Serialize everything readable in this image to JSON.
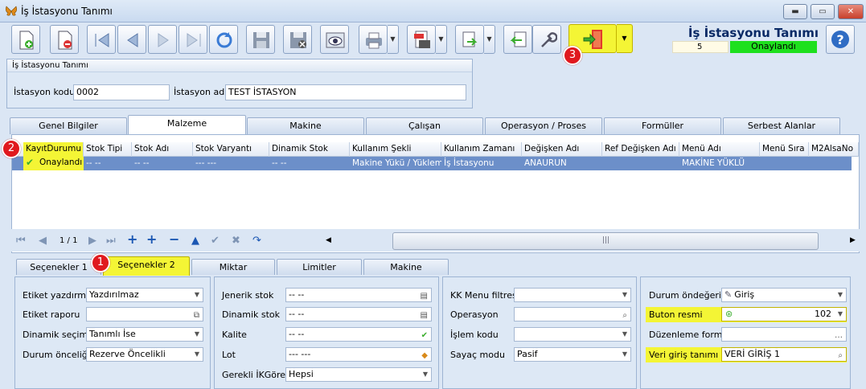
{
  "window": {
    "title": "İş İstasyonu Tanımı",
    "minimize": "▬",
    "maximize": "▭",
    "close": "✕"
  },
  "header": {
    "form_title": "İş İstasyonu Tanımı",
    "record_no": "5",
    "record_status": "Onaylandı",
    "help": "?"
  },
  "badges": {
    "b1": "1",
    "b2": "2",
    "b3": "3"
  },
  "group": {
    "title": "İş İstasyonu Tanımı",
    "code_label": "İstasyon kodu",
    "code_value": "0002",
    "name_label": "İstasyon adı",
    "name_value": "TEST İSTASYON"
  },
  "tabs": [
    "Genel Bilgiler",
    "Malzeme",
    "Makine",
    "Çalışan",
    "Operasyon / Proses",
    "Formüller",
    "Serbest Alanlar"
  ],
  "grid": {
    "columns": [
      "KayıtDurumu",
      "Stok Tipi",
      "Stok Adı",
      "Stok Varyantı",
      "Dinamik Stok",
      "Kullanım Şekli",
      "Kullanım Zamanı",
      "Değişken Adı",
      "Ref Değişken Adı",
      "Menü Adı",
      "Menü Sıra",
      "M2AlsaNo"
    ],
    "row": [
      "Onaylandı",
      "-- --",
      "-- --",
      "--- ---",
      "-- --",
      "Makine Yükü / Yükleme",
      "İş İstasyonu",
      "ANAURUN",
      "",
      "MAKİNE YÜKLÜ",
      "",
      ""
    ]
  },
  "nav": {
    "page": "1 / 1"
  },
  "subtabs": [
    "Seçenekler 1",
    "Seçenekler 2",
    "Miktar",
    "Limitler",
    "Makine"
  ],
  "panel1": {
    "l1": "Etiket yazdırma",
    "v1": "Yazdırılmaz",
    "l2": "Etiket raporu",
    "v2": "",
    "l3": "Dinamik seçim",
    "v3": "Tanımlı İse",
    "l4": "Durum önceliği",
    "v4": "Rezerve Öncelikli"
  },
  "panel2": {
    "l1": "Jenerik stok",
    "v1": "-- --",
    "l2": "Dinamik stok",
    "v2": "-- --",
    "l3": "Kalite",
    "v3": "-- --",
    "l4": "Lot",
    "v4": "--- ---",
    "l5": "Gerekli İKGörev",
    "v5": "Hepsi"
  },
  "panel3": {
    "l1": "KK Menu filtresi",
    "v1": "",
    "l2": "Operasyon",
    "v2": "",
    "l3": "İşlem kodu",
    "v3": "",
    "l4": "Sayaç modu",
    "v4": "Pasif"
  },
  "panel4": {
    "l1": "Durum öndeğeri",
    "v1": "Giriş",
    "l2": "Buton resmi",
    "v2": "102",
    "l3": "Düzenleme formu",
    "v3": "",
    "l4": "Veri giriş tanımı",
    "v4": "VERİ GİRİŞ 1"
  }
}
